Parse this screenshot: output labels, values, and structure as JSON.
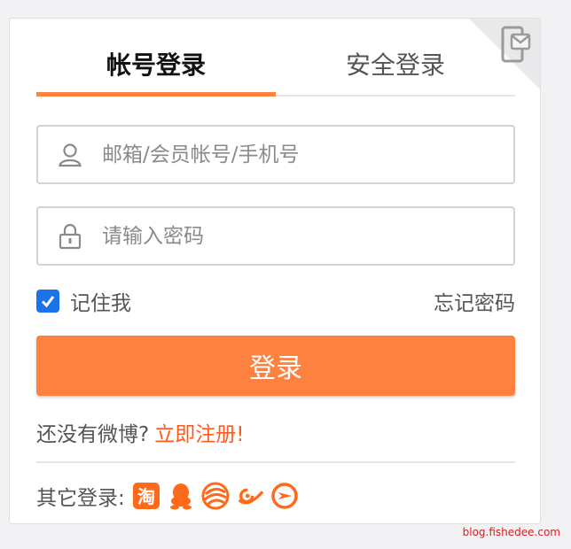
{
  "tabs": [
    {
      "label": "帐号登录",
      "active": true
    },
    {
      "label": "安全登录",
      "active": false
    }
  ],
  "form": {
    "username_placeholder": "邮箱/会员帐号/手机号",
    "password_placeholder": "请输入密码",
    "remember_label": "记住我",
    "remember_checked": true,
    "forgot_label": "忘记密码",
    "submit_label": "登录"
  },
  "register": {
    "prompt": "还没有微博?",
    "link": "立即注册!"
  },
  "other_login": {
    "label": "其它登录:",
    "icons": [
      "taobao-icon",
      "qq-icon",
      "china-mobile-icon",
      "tianyi-icon",
      "other-icon"
    ]
  },
  "watermark": "blog.fishedee.com",
  "colors": {
    "accent": "#ff8140",
    "link": "#ff5a1f",
    "checkbox": "#1a73e8"
  }
}
